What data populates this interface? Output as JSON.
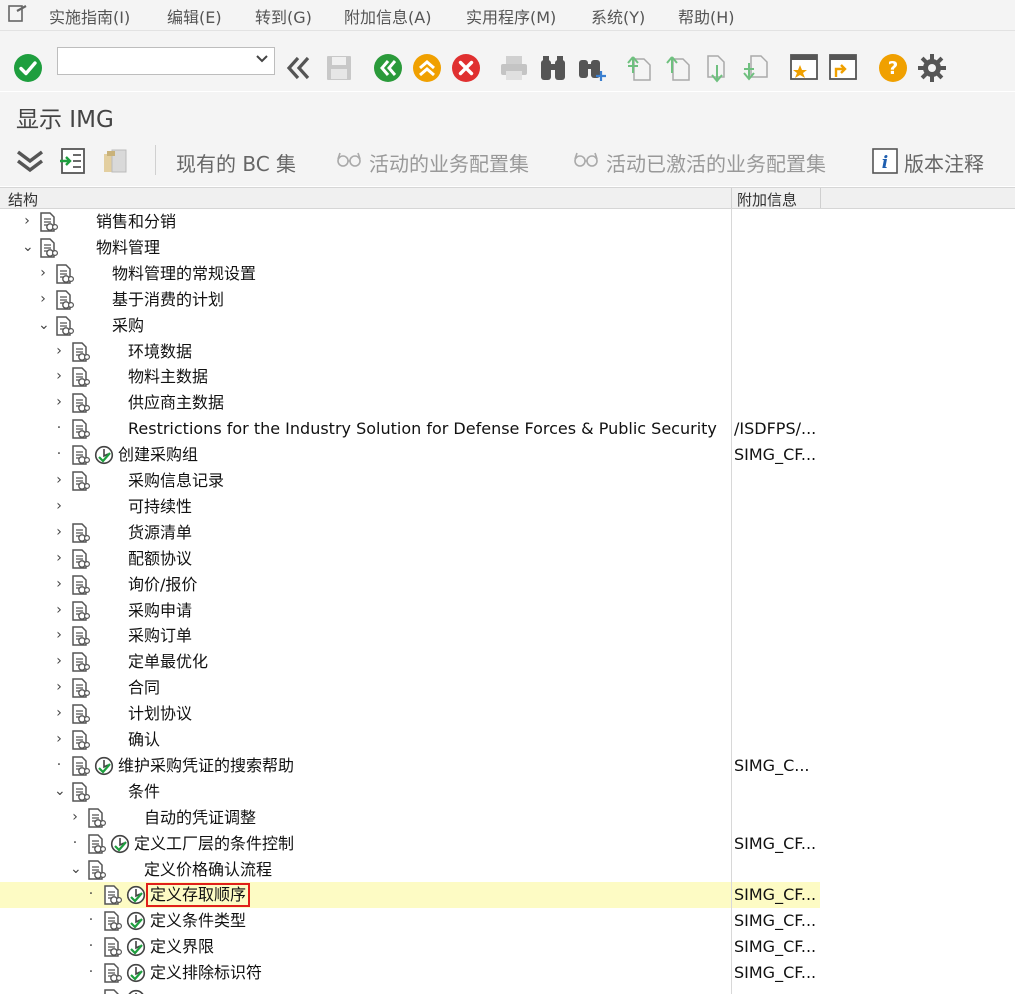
{
  "menu": [
    "实施指南(I)",
    "编辑(E)",
    "转到(G)",
    "附加信息(A)",
    "实用程序(M)",
    "系统(Y)",
    "帮助(H)"
  ],
  "command_field": {
    "value": ""
  },
  "title": "显示 IMG",
  "app_toolbar": {
    "existing_bc_sets": "现有的 BC 集",
    "active_bc_sets": "活动的业务配置集",
    "activated_bc_sets": "活动已激活的业务配置集",
    "release_notes": "版本注释"
  },
  "columns": {
    "structure": "结构",
    "additional_info": "附加信息"
  },
  "colors": {
    "selection_bg": "#fdfbc4",
    "focus_border": "#e0201a",
    "ok_green": "#1e9e3e",
    "back_green": "#2a9a3a",
    "exit_orange": "#f0a000",
    "cancel_red": "#e03030",
    "help_orange": "#f0a000"
  },
  "tree": [
    {
      "level": 0,
      "expander": "›",
      "node_icon": true,
      "exec_icon": false,
      "label": "销售和分销",
      "info": ""
    },
    {
      "level": 0,
      "expander": "⌄",
      "node_icon": true,
      "exec_icon": false,
      "label": "物料管理",
      "info": ""
    },
    {
      "level": 1,
      "expander": "›",
      "node_icon": true,
      "exec_icon": false,
      "label": "物料管理的常规设置",
      "info": ""
    },
    {
      "level": 1,
      "expander": "›",
      "node_icon": true,
      "exec_icon": false,
      "label": "基于消费的计划",
      "info": ""
    },
    {
      "level": 1,
      "expander": "⌄",
      "node_icon": true,
      "exec_icon": false,
      "label": "采购",
      "info": ""
    },
    {
      "level": 2,
      "expander": "›",
      "node_icon": true,
      "exec_icon": false,
      "label": "环境数据",
      "info": ""
    },
    {
      "level": 2,
      "expander": "›",
      "node_icon": true,
      "exec_icon": false,
      "label": "物料主数据",
      "info": ""
    },
    {
      "level": 2,
      "expander": "›",
      "node_icon": true,
      "exec_icon": false,
      "label": "供应商主数据",
      "info": ""
    },
    {
      "level": 2,
      "expander": "·",
      "node_icon": true,
      "exec_icon": false,
      "label": "Restrictions for the Industry Solution for Defense Forces & Public Security",
      "info": "/ISDFPS/..."
    },
    {
      "level": 2,
      "expander": "·",
      "node_icon": true,
      "exec_icon": true,
      "label": "创建采购组",
      "info": "SIMG_CF..."
    },
    {
      "level": 2,
      "expander": "›",
      "node_icon": true,
      "exec_icon": false,
      "label": "采购信息记录",
      "info": ""
    },
    {
      "level": 2,
      "expander": "›",
      "node_icon": false,
      "exec_icon": false,
      "label": "可持续性",
      "info": ""
    },
    {
      "level": 2,
      "expander": "›",
      "node_icon": true,
      "exec_icon": false,
      "label": "货源清单",
      "info": ""
    },
    {
      "level": 2,
      "expander": "›",
      "node_icon": true,
      "exec_icon": false,
      "label": "配额协议",
      "info": ""
    },
    {
      "level": 2,
      "expander": "›",
      "node_icon": true,
      "exec_icon": false,
      "label": "询价/报价",
      "info": ""
    },
    {
      "level": 2,
      "expander": "›",
      "node_icon": true,
      "exec_icon": false,
      "label": "采购申请",
      "info": ""
    },
    {
      "level": 2,
      "expander": "›",
      "node_icon": true,
      "exec_icon": false,
      "label": "采购订单",
      "info": ""
    },
    {
      "level": 2,
      "expander": "›",
      "node_icon": true,
      "exec_icon": false,
      "label": "定单最优化",
      "info": ""
    },
    {
      "level": 2,
      "expander": "›",
      "node_icon": true,
      "exec_icon": false,
      "label": "合同",
      "info": ""
    },
    {
      "level": 2,
      "expander": "›",
      "node_icon": true,
      "exec_icon": false,
      "label": "计划协议",
      "info": ""
    },
    {
      "level": 2,
      "expander": "›",
      "node_icon": true,
      "exec_icon": false,
      "label": "确认",
      "info": ""
    },
    {
      "level": 2,
      "expander": "·",
      "node_icon": true,
      "exec_icon": true,
      "label": "维护采购凭证的搜索帮助",
      "info": "SIMG_C..."
    },
    {
      "level": 2,
      "expander": "⌄",
      "node_icon": true,
      "exec_icon": false,
      "label": "条件",
      "info": ""
    },
    {
      "level": 3,
      "expander": "›",
      "node_icon": true,
      "exec_icon": false,
      "label": "自动的凭证调整",
      "info": ""
    },
    {
      "level": 3,
      "expander": "·",
      "node_icon": true,
      "exec_icon": true,
      "label": "定义工厂层的条件控制",
      "info": "SIMG_CF..."
    },
    {
      "level": 3,
      "expander": "⌄",
      "node_icon": true,
      "exec_icon": false,
      "label": "定义价格确认流程",
      "info": ""
    },
    {
      "level": 4,
      "expander": "·",
      "node_icon": true,
      "exec_icon": true,
      "label": "定义存取顺序",
      "info": "SIMG_CF...",
      "selected": true
    },
    {
      "level": 4,
      "expander": "·",
      "node_icon": true,
      "exec_icon": true,
      "label": "定义条件类型",
      "info": "SIMG_CF..."
    },
    {
      "level": 4,
      "expander": "·",
      "node_icon": true,
      "exec_icon": true,
      "label": "定义界限",
      "info": "SIMG_CF..."
    },
    {
      "level": 4,
      "expander": "·",
      "node_icon": true,
      "exec_icon": true,
      "label": "定义排除标识符",
      "info": "SIMG_CF..."
    },
    {
      "level": 4,
      "expander": "·",
      "node_icon": true,
      "exec_icon": true,
      "label": "",
      "info": ""
    }
  ]
}
